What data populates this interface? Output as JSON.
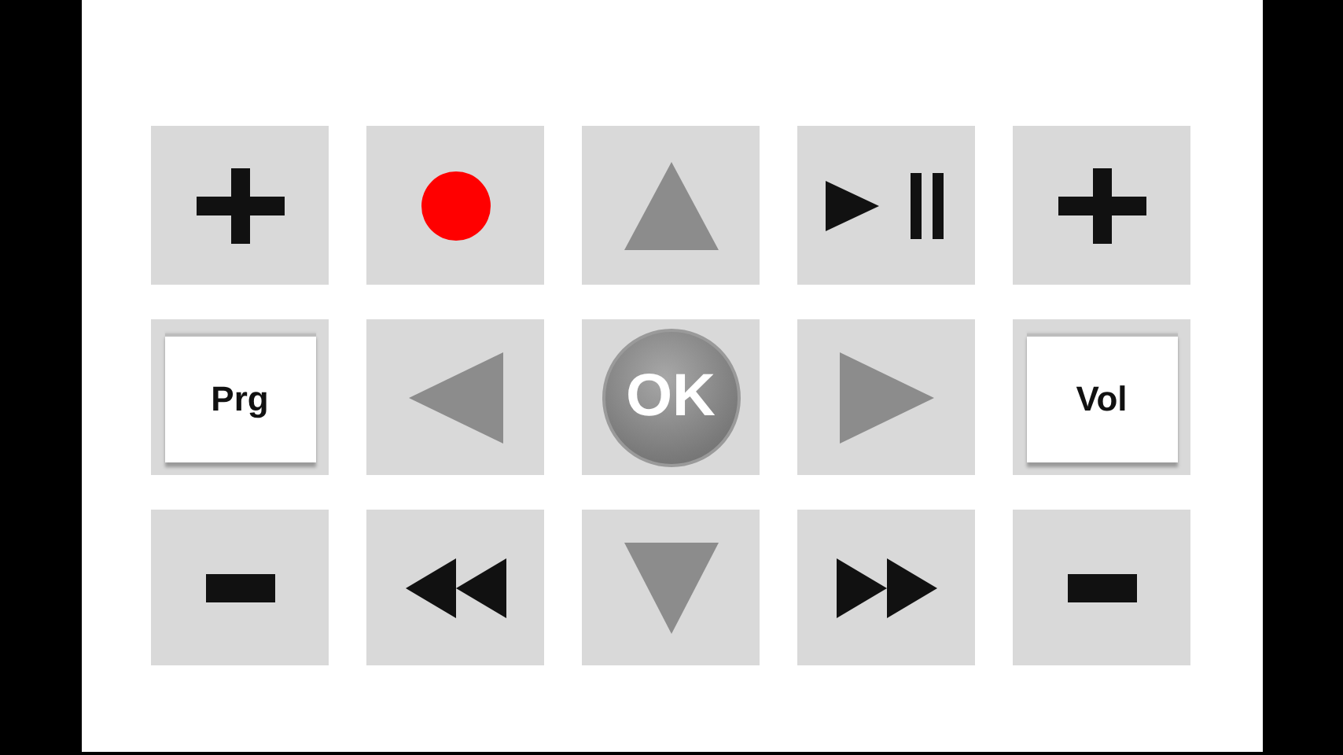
{
  "keys": [
    {
      "kind": "plus"
    },
    {
      "kind": "record"
    },
    {
      "kind": "up"
    },
    {
      "kind": "playpause"
    },
    {
      "kind": "plus"
    },
    {
      "kind": "label",
      "label": "Prg"
    },
    {
      "kind": "left"
    },
    {
      "kind": "ok",
      "label": "OK"
    },
    {
      "kind": "right"
    },
    {
      "kind": "label",
      "label": "Vol"
    },
    {
      "kind": "minus"
    },
    {
      "kind": "rewind"
    },
    {
      "kind": "down"
    },
    {
      "kind": "forward"
    },
    {
      "kind": "minus"
    }
  ]
}
